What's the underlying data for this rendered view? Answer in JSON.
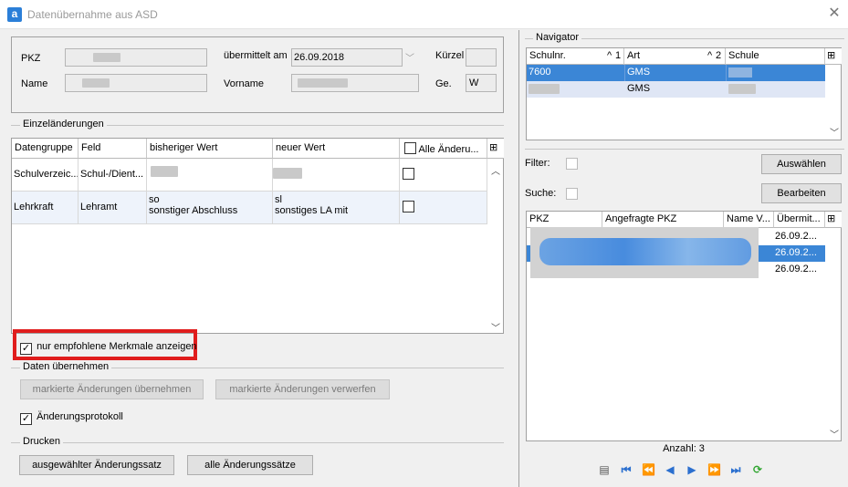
{
  "window": {
    "title": "Datenübernahme aus ASD",
    "app_icon_letter": "a"
  },
  "header": {
    "pkz_label": "PKZ",
    "name_label": "Name",
    "uebermittelt_label": "übermittelt am",
    "uebermittelt_value": "26.09.2018",
    "vorname_label": "Vorname",
    "kuerzel_label": "Kürzel",
    "ge_label": "Ge.",
    "ge_value": "W"
  },
  "einzel": {
    "section_title": "Einzeländerungen",
    "columns": [
      "Datengruppe",
      "Feld",
      "bisheriger Wert",
      "neuer Wert",
      "Alle Änderu..."
    ],
    "rows": [
      {
        "datengruppe": "Schulverzeic...",
        "feld": "Schul-/Dient...",
        "bisher_1": "",
        "bisher_2": "",
        "neu_1": "",
        "neu_2": "",
        "checked": false
      },
      {
        "datengruppe": "Lehrkraft",
        "feld": "Lehramt",
        "bisher_1": "so",
        "bisher_2": "sonstiger Abschluss",
        "neu_1": "sl",
        "neu_2": "sonstiges LA mit",
        "checked": false
      }
    ],
    "nur_empfohlene_label": "nur empfohlene Merkmale anzeigen",
    "nur_empfohlene_checked": true
  },
  "daten": {
    "section_title": "Daten übernehmen",
    "btn_uebernehmen": "markierte Änderungen übernehmen",
    "btn_verwerfen": "markierte Änderungen verwerfen",
    "protokoll_label": "Änderungsprotokoll",
    "protokoll_checked": true
  },
  "drucken": {
    "section_title": "Drucken",
    "btn_ausgewaehlt": "ausgewählter Änderungssatz",
    "btn_alle": "alle Änderungssätze"
  },
  "navigator": {
    "title": "Navigator",
    "columns": [
      "Schulnr.",
      "Art",
      "Schule"
    ],
    "sort_markers": [
      "1",
      "2"
    ],
    "rows": [
      {
        "schulnr": "7600",
        "art": "GMS",
        "schule": ""
      },
      {
        "schulnr": "",
        "art": "GMS",
        "schule": ""
      }
    ],
    "filter_label": "Filter:",
    "suche_label": "Suche:",
    "btn_auswaehlen": "Auswählen",
    "btn_bearbeiten": "Bearbeiten",
    "list_columns": [
      "PKZ",
      "Angefragte PKZ",
      "Name V...",
      "Übermit..."
    ],
    "list_rows": [
      {
        "datum": "26.09.2..."
      },
      {
        "datum": "26.09.2..."
      },
      {
        "datum": "26.09.2..."
      }
    ],
    "anzahl": "Anzahl: 3"
  },
  "colors": {
    "highlight": "#e01d1d",
    "selection": "#3b86d6",
    "accent": "#2b6fcf"
  }
}
